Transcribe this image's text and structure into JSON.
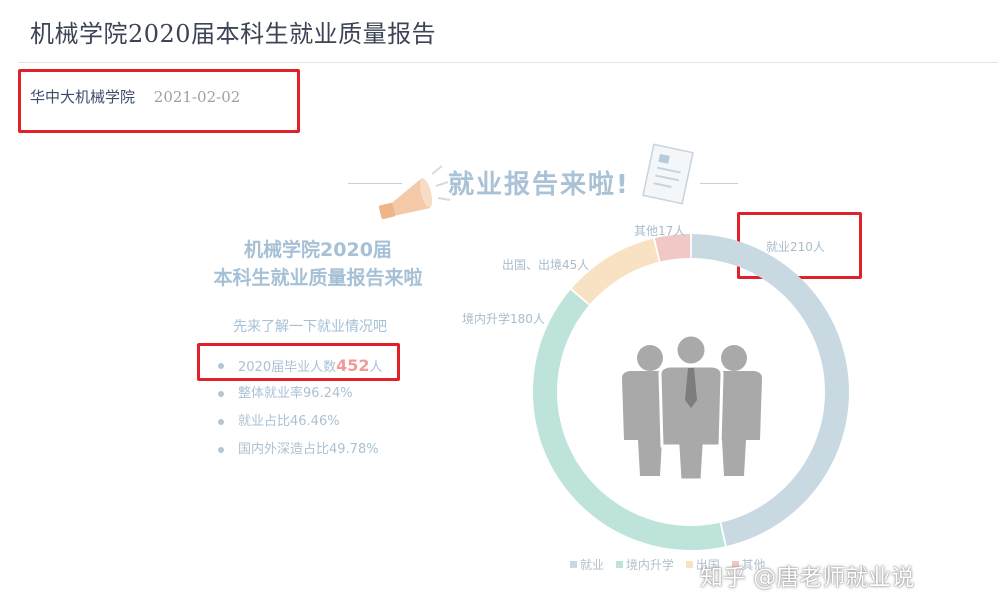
{
  "header": {
    "title": "机械学院2020届本科生就业质量报告"
  },
  "meta": {
    "author": "华中大机械学院",
    "date": "2021-02-02"
  },
  "banner": {
    "title": "就业报告来啦!"
  },
  "report": {
    "heading_line1": "机械学院2020届",
    "heading_line2": "本科生就业质量报告来啦",
    "intro": "先来了解一下就业情况吧",
    "stats": [
      {
        "prefix": "2020届毕业人数",
        "number": "452",
        "suffix": "人"
      },
      {
        "text": "整体就业率96.24%"
      },
      {
        "text": "就业占比46.46%"
      },
      {
        "text": "国内外深造占比49.78%"
      }
    ]
  },
  "chart_data": {
    "type": "pie",
    "categories": [
      "就业",
      "境内升学",
      "出国、出境",
      "其他"
    ],
    "values": [
      210,
      180,
      45,
      17
    ],
    "labels": [
      "就业210人",
      "境内升学180人",
      "出国、出境45人",
      "其他17人"
    ],
    "colors": [
      "#c8d9e2",
      "#bde3da",
      "#f9e2c4",
      "#f0c9c6"
    ],
    "legend": [
      "就业",
      "境内升学",
      "出国",
      "其他"
    ]
  },
  "watermark": "知乎 @唐老师就业说",
  "colors": {
    "highlight_box": "#e0202a",
    "accent_number": "#f29a9a"
  }
}
